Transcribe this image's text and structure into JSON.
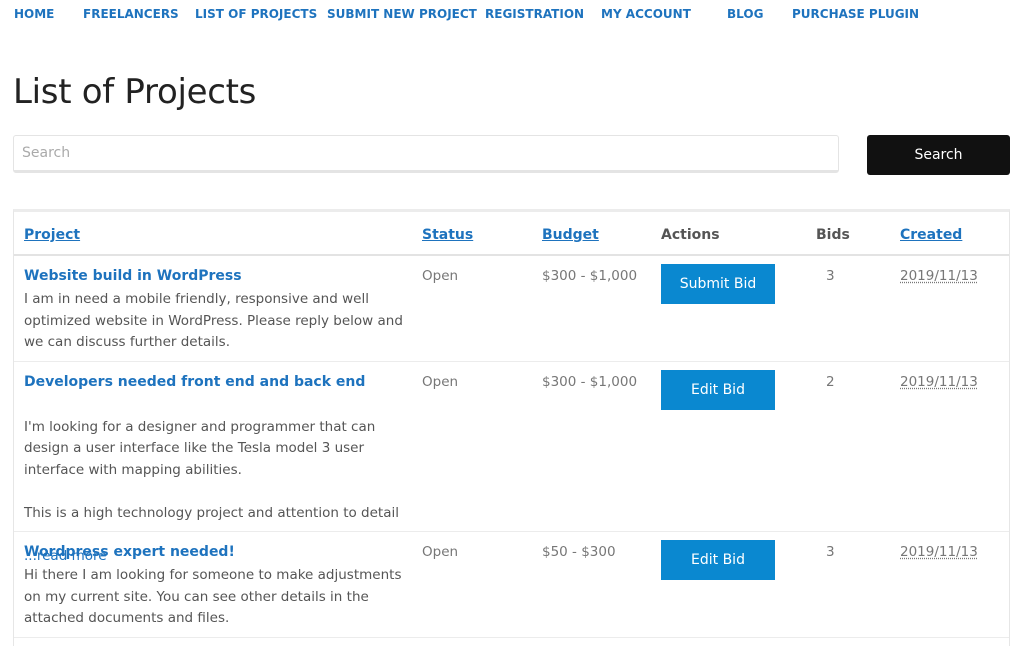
{
  "nav": {
    "items": [
      {
        "label": "HOME"
      },
      {
        "label": "FREELANCERS"
      },
      {
        "label": "LIST OF PROJECTS"
      },
      {
        "label": "SUBMIT NEW PROJECT"
      },
      {
        "label": "REGISTRATION"
      },
      {
        "label": "MY ACCOUNT"
      },
      {
        "label": "BLOG"
      },
      {
        "label": "PURCHASE PLUGIN"
      }
    ]
  },
  "page": {
    "title": "List of Projects"
  },
  "search": {
    "placeholder": "Search",
    "value": "",
    "button_label": "Search"
  },
  "table": {
    "headers": {
      "project": "Project",
      "status": "Status",
      "budget": "Budget",
      "actions": "Actions",
      "bids": "Bids",
      "created": "Created"
    },
    "rows": [
      {
        "title": "Website build in WordPress",
        "description": "I am in need a mobile friendly, responsive and well optimized website in WordPress. Please reply below and we can discuss further details.",
        "status": "Open",
        "budget": "$300 - $1,000",
        "action": "Submit Bid",
        "bids": "3",
        "created": "2019/11/13"
      },
      {
        "title": "Developers needed front end and back end",
        "description": "I'm looking for a designer and programmer that can design a user interface like the Tesla model 3 user interface with mapping abilities.\n\nThis is a high technology project and attention to detail",
        "read_more": "...read more",
        "status": "Open",
        "budget": "$300 - $1,000",
        "action": "Edit Bid",
        "bids": "2",
        "created": "2019/11/13"
      },
      {
        "title": "Wordpress expert needed!",
        "description": "Hi there I am looking for someone to make adjustments on my current site. You can see other details in the attached documents and files.",
        "status": "Open",
        "budget": "$50 - $300",
        "action": "Edit Bid",
        "bids": "3",
        "created": "2019/11/13"
      }
    ]
  },
  "colors": {
    "link": "#1e73be",
    "button": "#0a88d0",
    "search_button": "#111111"
  }
}
